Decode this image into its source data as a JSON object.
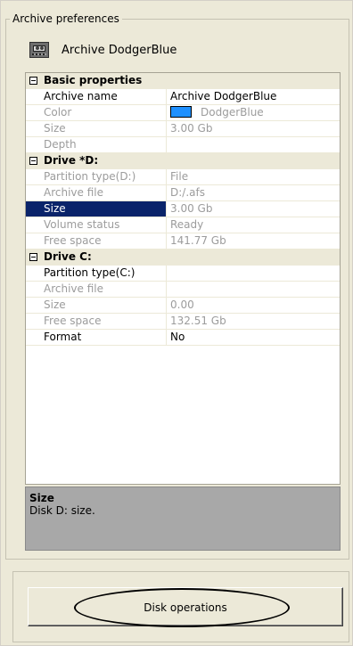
{
  "group": {
    "legend": "Archive preferences"
  },
  "header": {
    "title": "Archive DodgerBlue",
    "icon": "archive-tape-icon"
  },
  "properties": {
    "basic": {
      "title": "Basic properties",
      "rows": [
        {
          "name": "Archive name",
          "value": "Archive DodgerBlue"
        },
        {
          "name": "Color",
          "value": "DodgerBlue",
          "color": "#1e90ff"
        },
        {
          "name": "Size",
          "value": "3.00 Gb"
        },
        {
          "name": "Depth",
          "value": ""
        }
      ]
    },
    "drive_d": {
      "title": "Drive *D:",
      "rows": [
        {
          "name": "Partition type(D:)",
          "value": "File"
        },
        {
          "name": "Archive file",
          "value": "D:/.afs"
        },
        {
          "name": "Size",
          "value": "3.00 Gb"
        },
        {
          "name": "Volume status",
          "value": "Ready"
        },
        {
          "name": "Free space",
          "value": "141.77 Gb"
        }
      ]
    },
    "drive_c": {
      "title": "Drive C:",
      "rows": [
        {
          "name": "Partition type(C:)",
          "value": ""
        },
        {
          "name": "Archive file",
          "value": ""
        },
        {
          "name": "Size",
          "value": "0.00"
        },
        {
          "name": "Free space",
          "value": "132.51 Gb"
        },
        {
          "name": "Format",
          "value": "No"
        }
      ]
    }
  },
  "description": {
    "title": "Size",
    "text": "Disk D: size."
  },
  "actions": {
    "disk_operations_label": "Disk operations"
  },
  "colors": {
    "selection": "#0a246a",
    "category_background": "#ece9d8",
    "swatch": "#1e90ff"
  }
}
